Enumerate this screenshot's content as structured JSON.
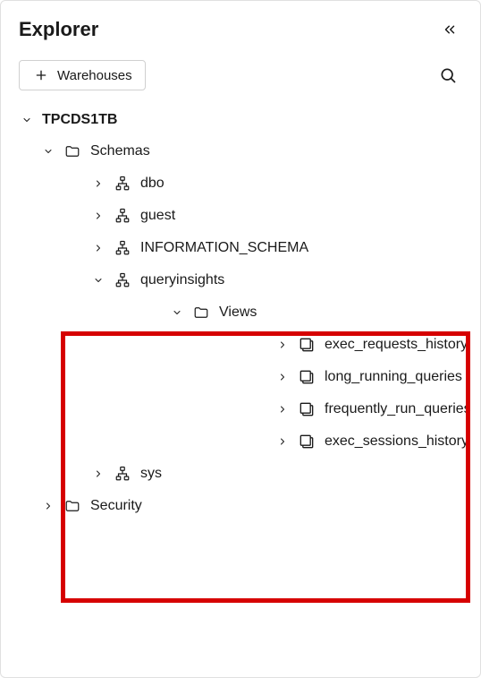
{
  "header": {
    "title": "Explorer"
  },
  "toolbar": {
    "add_label": "Warehouses"
  },
  "tree": {
    "root": {
      "label": "TPCDS1TB"
    },
    "schemas_folder": "Schemas",
    "schemas": {
      "dbo": "dbo",
      "guest": "guest",
      "info_schema": "INFORMATION_SCHEMA",
      "queryinsights": "queryinsights",
      "sys": "sys"
    },
    "views_folder": "Views",
    "views": {
      "exec_requests_history": "exec_requests_history",
      "long_running_queries": "long_running_queries",
      "frequently_run_queries": "frequently_run_queries",
      "exec_sessions_history": "exec_sessions_history"
    },
    "security_folder": "Security"
  }
}
